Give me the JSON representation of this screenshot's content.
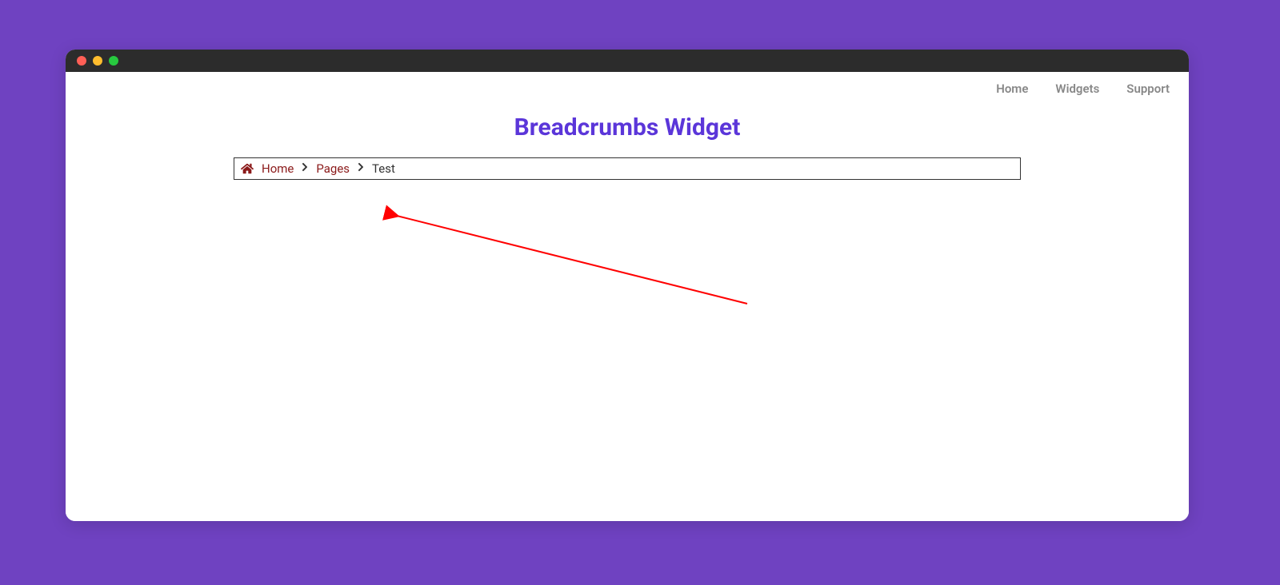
{
  "nav": {
    "items": [
      {
        "label": "Home"
      },
      {
        "label": "Widgets"
      },
      {
        "label": "Support"
      }
    ]
  },
  "page": {
    "title": "Breadcrumbs Widget"
  },
  "breadcrumb": {
    "home_label": "Home",
    "pages_label": "Pages",
    "current_label": "Test"
  },
  "colors": {
    "background": "#6f42c1",
    "title": "#5b36d9",
    "breadcrumb_link": "#8b1a1a",
    "arrow": "#ff0000"
  }
}
